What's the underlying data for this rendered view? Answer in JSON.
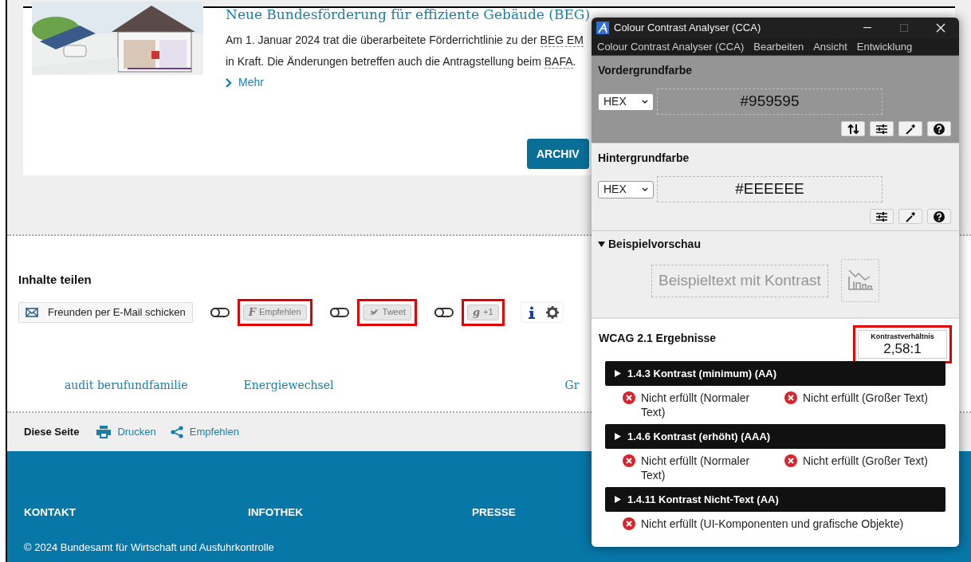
{
  "article": {
    "title": "Neue Bundesförderung für effiziente Gebäude (BEG)",
    "body": [
      {
        "text": "Am 1. Januar 2024 trat die überarbeitete Förderrichtlinie zu der ",
        "abbr": false
      },
      {
        "text": "BEG EM",
        "abbr": true
      },
      {
        "text": " in Kraft. Die Änderungen betreffen auch die Antragstellung beim ",
        "abbr": false
      },
      {
        "text": "BAFA",
        "abbr": true
      },
      {
        "text": ".",
        "abbr": false
      }
    ],
    "more": "Mehr",
    "archive_button": "ARCHIV"
  },
  "share": {
    "title": "Inhalte teilen",
    "email_button": "Freunden per E-Mail schicken",
    "services": [
      {
        "kind": "glyph",
        "glyph": "F",
        "label": "Empfehlen",
        "on": false,
        "highlighted": true
      },
      {
        "kind": "bird",
        "label": "Tweet",
        "on": false,
        "highlighted": true
      },
      {
        "kind": "glyph",
        "glyph": "g",
        "label": "+1",
        "on": false,
        "highlighted": true
      }
    ]
  },
  "links": [
    "audit berufundfamilie",
    "Energiewechsel",
    "Gr"
  ],
  "page_tools": {
    "label": "Diese Seite",
    "actions": [
      {
        "kind": "print",
        "label": "Drucken"
      },
      {
        "kind": "share",
        "label": "Empfehlen"
      }
    ]
  },
  "footer": {
    "columns": [
      "KONTAKT",
      "INFOTHEK",
      "PRESSE"
    ],
    "copyright": "© 2024 Bundesamt für Wirtschaft und Ausfuhrkontrolle"
  },
  "cca": {
    "title": "Colour Contrast Analyser (CCA)",
    "menu": [
      "Colour Contrast Analyser (CCA)",
      "Bearbeiten",
      "Ansicht",
      "Entwicklung"
    ],
    "foreground": {
      "label": "Vordergrundfarbe",
      "format": "HEX",
      "value": "#959595",
      "color": "#959595"
    },
    "background": {
      "label": "Hintergrundfarbe",
      "format": "HEX",
      "value": "#EEEEEE",
      "color": "#eeeeee"
    },
    "preview": {
      "label": "Beispielvorschau",
      "expanded": true,
      "sample": "Beispieltext mit Kontrast"
    },
    "results": {
      "title": "WCAG 2.1 Ergebnisse",
      "ratio_label": "Kontrastverhältnis",
      "ratio": "2,58:1",
      "highlighted": true,
      "criteria": [
        {
          "title": "1.4.3 Kontrast (minimum) (AA)",
          "expanded": false,
          "results": [
            {
              "label": "Nicht erfüllt (Normaler Text)",
              "passed": false
            },
            {
              "label": "Nicht erfüllt (Großer Text)",
              "passed": false
            }
          ]
        },
        {
          "title": "1.4.6 Kontrast (erhöht) (AAA)",
          "expanded": false,
          "results": [
            {
              "label": "Nicht erfüllt (Normaler Text)",
              "passed": false
            },
            {
              "label": "Nicht erfüllt (Großer Text)",
              "passed": false
            }
          ]
        },
        {
          "title": "1.4.11 Kontrast Nicht-Text (AA)",
          "expanded": false,
          "results": [
            {
              "label": "Nicht erfüllt (UI-Komponenten und grafische Objekte)",
              "passed": false
            }
          ]
        }
      ]
    }
  }
}
